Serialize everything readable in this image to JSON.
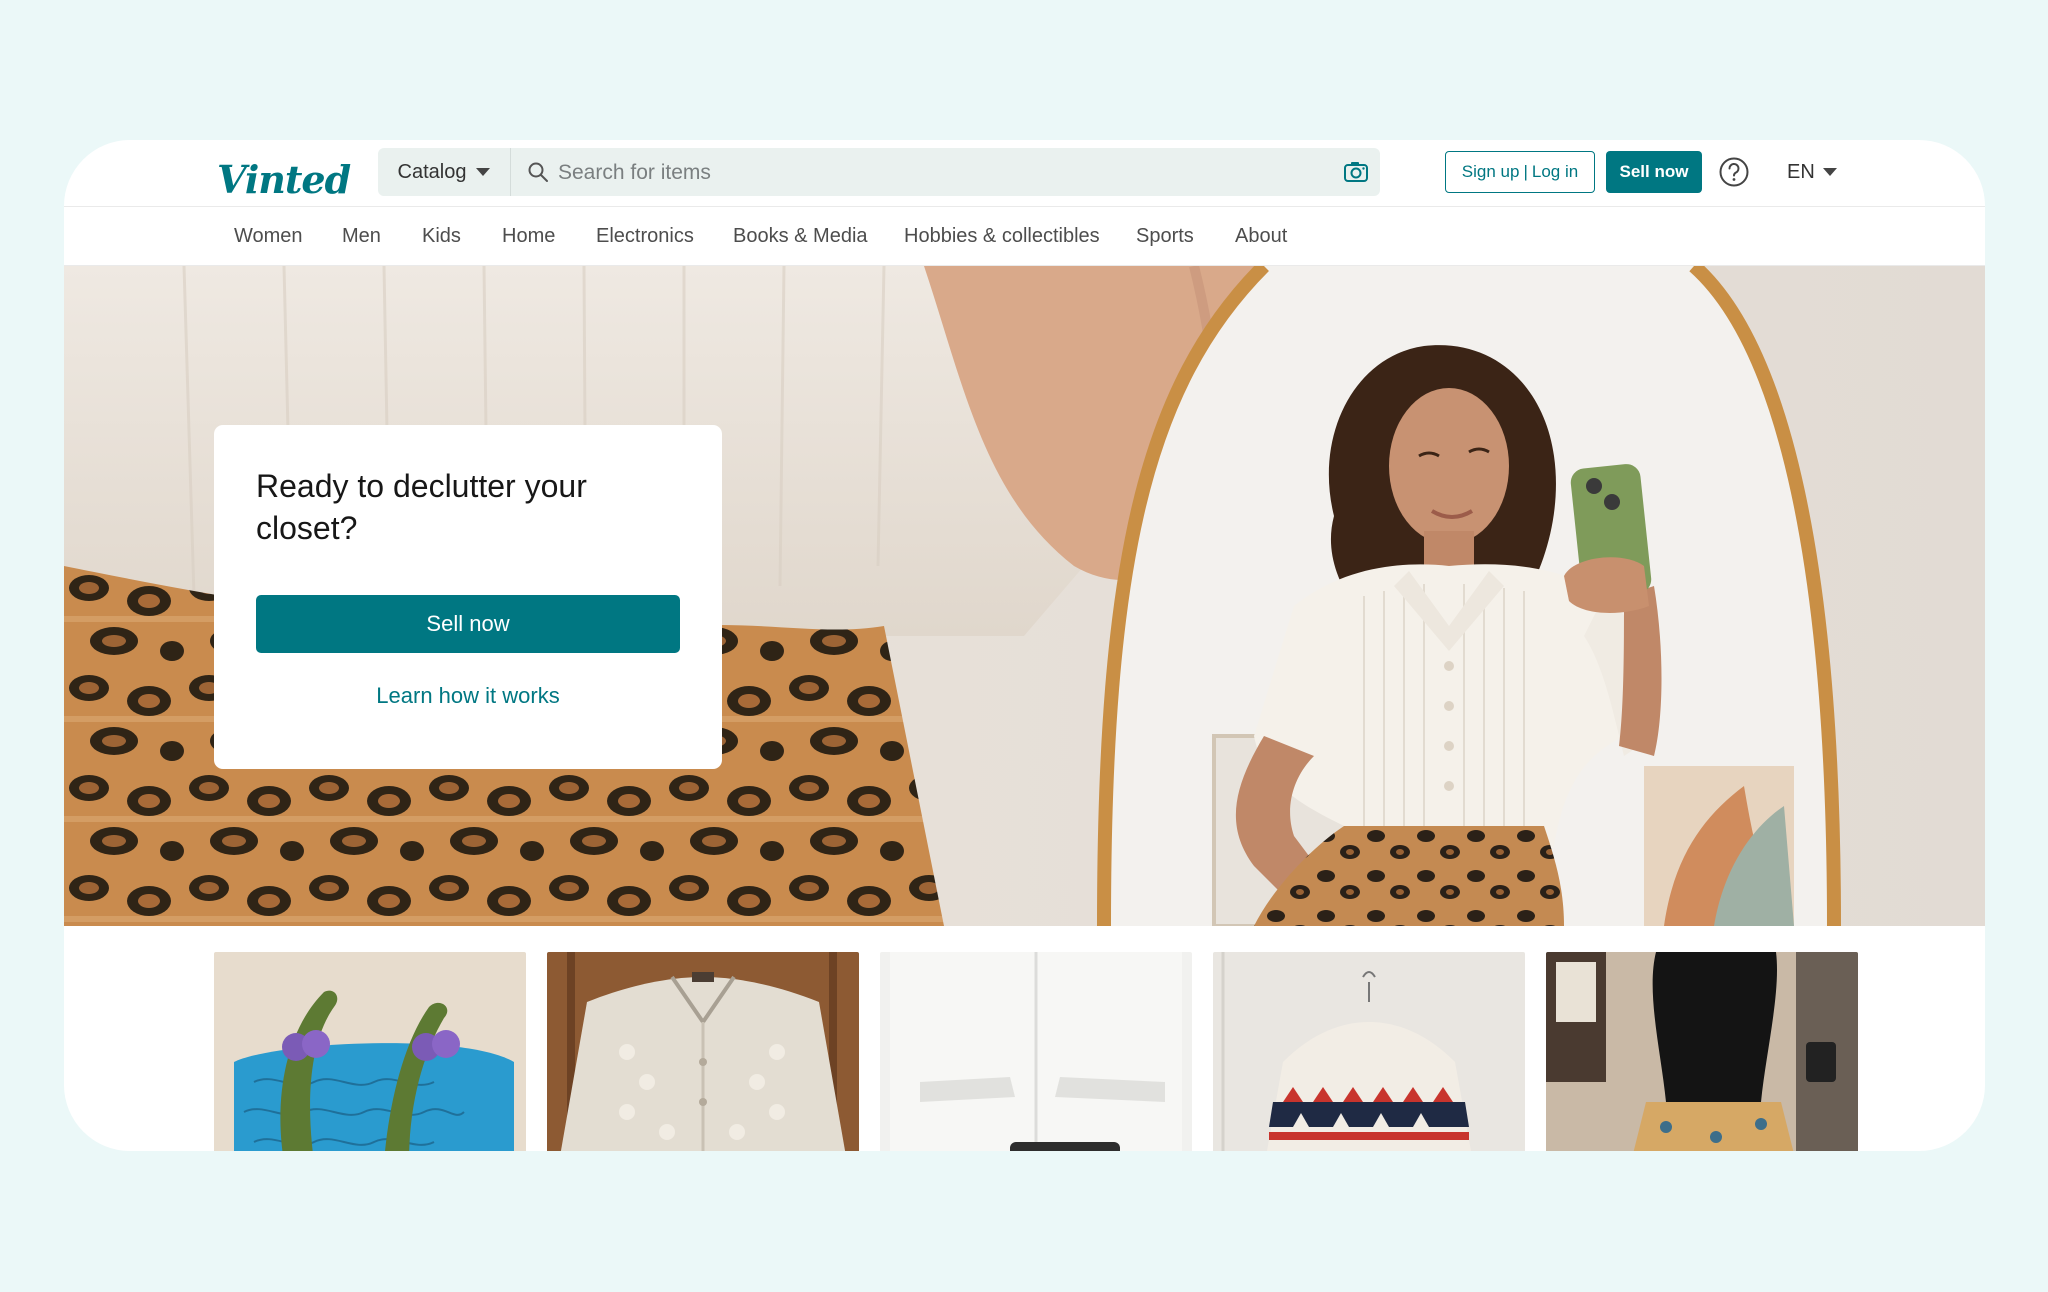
{
  "brand": {
    "logo_text": "Vinted",
    "accent_color": "#007782"
  },
  "header": {
    "catalog_label": "Catalog",
    "search_placeholder": "Search for items",
    "search_value": "",
    "signup_label": "Sign up",
    "auth_separator": "|",
    "login_label": "Log in",
    "sell_label": "Sell now",
    "help_icon": "question-circle-icon",
    "camera_icon": "camera-search-icon",
    "language": "EN"
  },
  "nav": {
    "items": [
      {
        "label": "Women"
      },
      {
        "label": "Men"
      },
      {
        "label": "Kids"
      },
      {
        "label": "Home"
      },
      {
        "label": "Electronics"
      },
      {
        "label": "Books & Media"
      },
      {
        "label": "Hobbies & collectibles"
      },
      {
        "label": "Sports"
      },
      {
        "label": "About"
      }
    ]
  },
  "hero": {
    "title": "Ready to declutter your closet?",
    "sell_button": "Sell now",
    "learn_link": "Learn how it works"
  },
  "thumbnails": [
    {
      "name": "thumbnail-blue-bag"
    },
    {
      "name": "thumbnail-cream-cardigan"
    },
    {
      "name": "thumbnail-white-door"
    },
    {
      "name": "thumbnail-fairisle-sweater"
    },
    {
      "name": "thumbnail-black-top"
    }
  ]
}
